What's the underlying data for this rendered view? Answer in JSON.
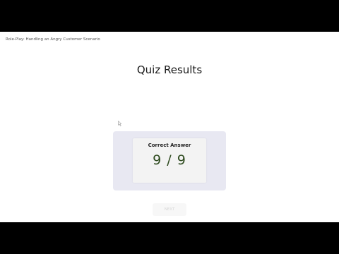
{
  "header": {
    "title": "Role-Play: Handling an Angry Customer Scenario"
  },
  "page": {
    "title": "Quiz Results"
  },
  "result": {
    "label": "Correct Answer",
    "score": "9 / 9"
  },
  "footer": {
    "next_label": "NEXT"
  },
  "colors": {
    "card_background": "#e8e8f2",
    "score_text": "#2d4a1e",
    "letterbox": "#000000"
  }
}
